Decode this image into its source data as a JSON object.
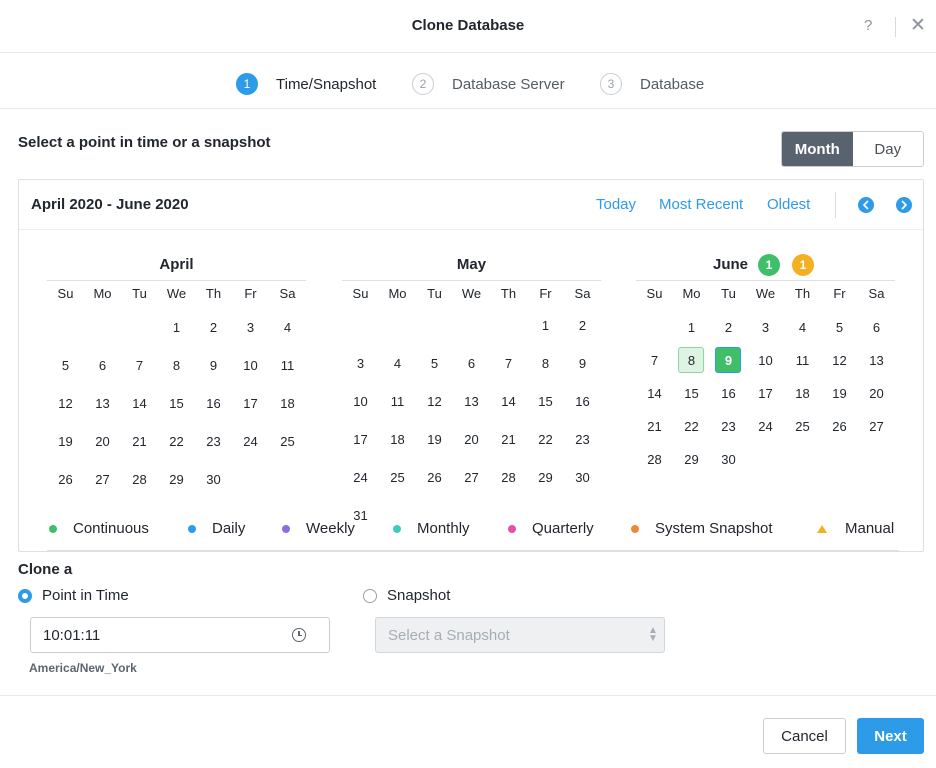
{
  "dialog": {
    "title": "Clone Database",
    "help_label": "?",
    "close_icon": "close-icon"
  },
  "steps": [
    {
      "num": "1",
      "label": "Time/Snapshot",
      "active": true
    },
    {
      "num": "2",
      "label": "Database Server",
      "active": false
    },
    {
      "num": "3",
      "label": "Database",
      "active": false
    }
  ],
  "section_title": "Select a point in time or a snapshot",
  "view_toggle": {
    "month": "Month",
    "day": "Day",
    "selected": "Month"
  },
  "calendar": {
    "range_label": "April 2020 - June 2020",
    "links": {
      "today": "Today",
      "most_recent": "Most Recent",
      "oldest": "Oldest"
    },
    "nav": {
      "prev_icon": "chevron-left-icon",
      "next_icon": "chevron-right-icon"
    },
    "weekdays": [
      "Su",
      "Mo",
      "Tu",
      "We",
      "Th",
      "Fr",
      "Sa"
    ],
    "months": [
      {
        "name": "April",
        "weeks": [
          [
            "",
            "",
            "",
            "1",
            "2",
            "3",
            "4"
          ],
          [
            "5",
            "6",
            "7",
            "8",
            "9",
            "10",
            "11"
          ],
          [
            "12",
            "13",
            "14",
            "15",
            "16",
            "17",
            "18"
          ],
          [
            "19",
            "20",
            "21",
            "22",
            "23",
            "24",
            "25"
          ],
          [
            "26",
            "27",
            "28",
            "29",
            "30",
            "",
            ""
          ]
        ]
      },
      {
        "name": "May",
        "weeks": [
          [
            "",
            "",
            "",
            "",
            "",
            "1",
            "2"
          ],
          [
            "3",
            "4",
            "5",
            "6",
            "7",
            "8",
            "9"
          ],
          [
            "10",
            "11",
            "12",
            "13",
            "14",
            "15",
            "16"
          ],
          [
            "17",
            "18",
            "19",
            "20",
            "21",
            "22",
            "23"
          ],
          [
            "24",
            "25",
            "26",
            "27",
            "28",
            "29",
            "30"
          ],
          [
            "31",
            "",
            "",
            "",
            "",
            "",
            ""
          ]
        ]
      },
      {
        "name": "June",
        "badges": [
          {
            "value": "1",
            "color": "#3fbf6a"
          },
          {
            "value": "1",
            "color": "#f3b021"
          }
        ],
        "weeks": [
          [
            "",
            "1",
            "2",
            "3",
            "4",
            "5",
            "6"
          ],
          [
            "7",
            "8",
            "9",
            "10",
            "11",
            "12",
            "13"
          ],
          [
            "14",
            "15",
            "16",
            "17",
            "18",
            "19",
            "20"
          ],
          [
            "21",
            "22",
            "23",
            "24",
            "25",
            "26",
            "27"
          ],
          [
            "28",
            "29",
            "30",
            "",
            "",
            "",
            ""
          ]
        ],
        "highlighted_days": [
          "8",
          "9"
        ],
        "selected_day": "9"
      }
    ],
    "legend": [
      {
        "label": "Continuous",
        "color": "#3fbf6a",
        "shape": "dot"
      },
      {
        "label": "Daily",
        "color": "#2d9be8",
        "shape": "dot"
      },
      {
        "label": "Weekly",
        "color": "#8b6fe0",
        "shape": "dot"
      },
      {
        "label": "Monthly",
        "color": "#3ccdc0",
        "shape": "dot"
      },
      {
        "label": "Quarterly",
        "color": "#e84fa6",
        "shape": "dot"
      },
      {
        "label": "System Snapshot",
        "color": "#f0873a",
        "shape": "dot"
      },
      {
        "label": "Manual",
        "color": "#f3b021",
        "shape": "triangle"
      }
    ]
  },
  "clone": {
    "label": "Clone a",
    "options": {
      "point_in_time": "Point in Time",
      "snapshot": "Snapshot"
    },
    "selected": "Point in Time",
    "time_value": "10:01:11",
    "timezone": "America/New_York",
    "snapshot_placeholder": "Select a Snapshot"
  },
  "footer": {
    "cancel": "Cancel",
    "next": "Next"
  },
  "colors": {
    "accent": "#2d9be8",
    "toggle_active": "#58636f"
  }
}
